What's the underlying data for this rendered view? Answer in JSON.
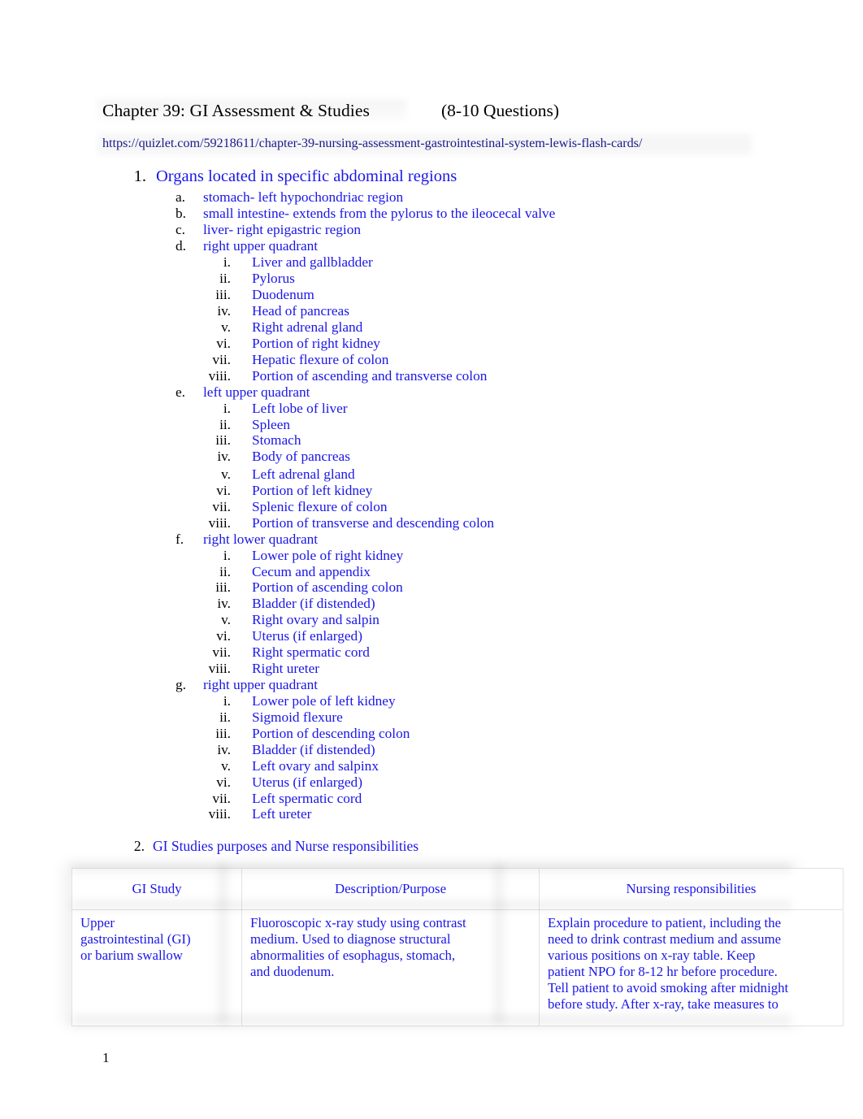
{
  "document": {
    "title": "Chapter 39: GI Assessment & Studies",
    "questions_count": "(8-10 Questions)",
    "source_url": "https://quizlet.com/59218611/chapter-39-nursing-assessment-gastrointestinal-system-lewis-flash-cards/",
    "page_number": "1",
    "colors": {
      "body_blue": "#1a17e8",
      "url_navy": "#1a1a8c",
      "marker_black": "#000000",
      "table_border": "#e2e2e2"
    }
  },
  "outline": {
    "item1": {
      "marker": "1.",
      "text": "Organs located in specific abdominal regions",
      "sub": [
        {
          "marker": "a.",
          "text": "stomach- left hypochondriac region",
          "children": []
        },
        {
          "marker": "b.",
          "text": "small intestine- extends from the pylorus to the ileocecal valve",
          "children": []
        },
        {
          "marker": "c.",
          "text": "liver- right epigastric region",
          "children": []
        },
        {
          "marker": "d.",
          "text": "right upper quadrant",
          "children": [
            {
              "marker": "i.",
              "text": "Liver and gallbladder"
            },
            {
              "marker": "ii.",
              "text": "Pylorus"
            },
            {
              "marker": "iii.",
              "text": "Duodenum"
            },
            {
              "marker": "iv.",
              "text": "Head of pancreas"
            },
            {
              "marker": "v.",
              "text": "Right adrenal gland"
            },
            {
              "marker": "vi.",
              "text": "Portion of right kidney"
            },
            {
              "marker": "vii.",
              "text": "Hepatic flexure of colon"
            },
            {
              "marker": "viii.",
              "text": "Portion of ascending and transverse colon"
            }
          ]
        },
        {
          "marker": "e.",
          "text": "left upper quadrant",
          "children": [
            {
              "marker": "i.",
              "text": "Left lobe of liver"
            },
            {
              "marker": "ii.",
              "text": "Spleen"
            },
            {
              "marker": "iii.",
              "text": "Stomach"
            },
            {
              "marker": "iv.",
              "text": "Body of pancreas"
            },
            {
              "marker": "v.",
              "text": "Left adrenal gland"
            },
            {
              "marker": "vi.",
              "text": "Portion of left kidney"
            },
            {
              "marker": "vii.",
              "text": "Splenic flexure of colon"
            },
            {
              "marker": "viii.",
              "text": "Portion of transverse and descending colon"
            }
          ]
        },
        {
          "marker": "f.",
          "text": "right lower quadrant",
          "children": [
            {
              "marker": "i.",
              "text": "Lower pole of right kidney"
            },
            {
              "marker": "ii.",
              "text": "Cecum and appendix"
            },
            {
              "marker": "iii.",
              "text": "Portion of ascending colon"
            },
            {
              "marker": "iv.",
              "text": "Bladder (if distended)"
            },
            {
              "marker": "v.",
              "text": "Right ovary and salpin"
            },
            {
              "marker": "vi.",
              "text": "Uterus (if enlarged)"
            },
            {
              "marker": "vii.",
              "text": "Right spermatic cord"
            },
            {
              "marker": "viii.",
              "text": "Right ureter"
            }
          ]
        },
        {
          "marker": "g.",
          "text": "right upper quadrant",
          "children": [
            {
              "marker": "i.",
              "text": "Lower pole of left kidney"
            },
            {
              "marker": "ii.",
              "text": "Sigmoid flexure"
            },
            {
              "marker": "iii.",
              "text": "Portion of descending colon"
            },
            {
              "marker": "iv.",
              "text": "Bladder (if distended)"
            },
            {
              "marker": "v.",
              "text": "Left ovary and salpinx"
            },
            {
              "marker": "vi.",
              "text": "Uterus (if enlarged)"
            },
            {
              "marker": "vii.",
              "text": "Left spermatic cord"
            },
            {
              "marker": "viii.",
              "text": "Left ureter"
            }
          ]
        }
      ]
    },
    "item2": {
      "marker": "2.",
      "text": "GI Studies purposes and Nurse responsibilities"
    }
  },
  "gi_table": {
    "headers": [
      "GI Study",
      "Description/Purpose",
      "Nursing responsibilities"
    ],
    "rows": [
      {
        "study_lines": [
          "Upper",
          "gastrointestinal (GI)",
          "or barium swallow"
        ],
        "description_lines": [
          "Fluoroscopic x-ray study using contrast",
          "medium. Used to diagnose structural",
          "abnormalities of esophagus, stomach,",
          "and duodenum."
        ],
        "nursing_lines": [
          "Explain procedure to patient, including the",
          "need to drink contrast medium and assume",
          "various positions on x-ray table. Keep",
          "patient NPO for 8-12 hr before procedure.",
          "Tell patient to avoid smoking after midnight",
          "before study. After x-ray, take measures to"
        ]
      }
    ]
  }
}
